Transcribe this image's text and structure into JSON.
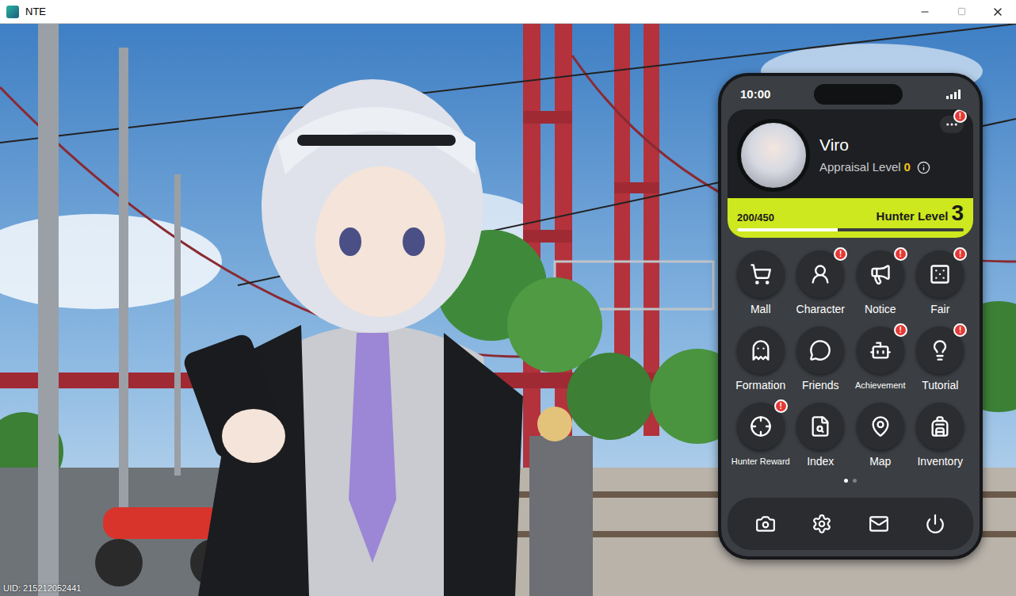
{
  "window": {
    "title": "NTE"
  },
  "phone": {
    "time": "10:00",
    "profile": {
      "name": "Viro",
      "appraisal_label": "Appraisal Level",
      "appraisal_value": "0",
      "menu_badge": true,
      "xp": "200/450",
      "xp_level": 0.444,
      "hunter_label": "Hunter Level",
      "hunter_value": "3"
    },
    "badge_text": "!",
    "apps": [
      {
        "label": "Mall",
        "badge": false
      },
      {
        "label": "Character",
        "badge": true
      },
      {
        "label": "Notice",
        "badge": true
      },
      {
        "label": "Fair",
        "badge": true
      },
      {
        "label": "Formation",
        "badge": false
      },
      {
        "label": "Friends",
        "badge": false
      },
      {
        "label": "Achievement",
        "badge": true
      },
      {
        "label": "Tutorial",
        "badge": true
      },
      {
        "label": "Hunter Reward",
        "badge": true
      },
      {
        "label": "Index",
        "badge": false
      },
      {
        "label": "Map",
        "badge": false
      },
      {
        "label": "Inventory",
        "badge": false
      }
    ],
    "pages": [
      {
        "selected": true
      },
      {
        "selected": false
      }
    ]
  },
  "uid": "UID: 215212052441"
}
